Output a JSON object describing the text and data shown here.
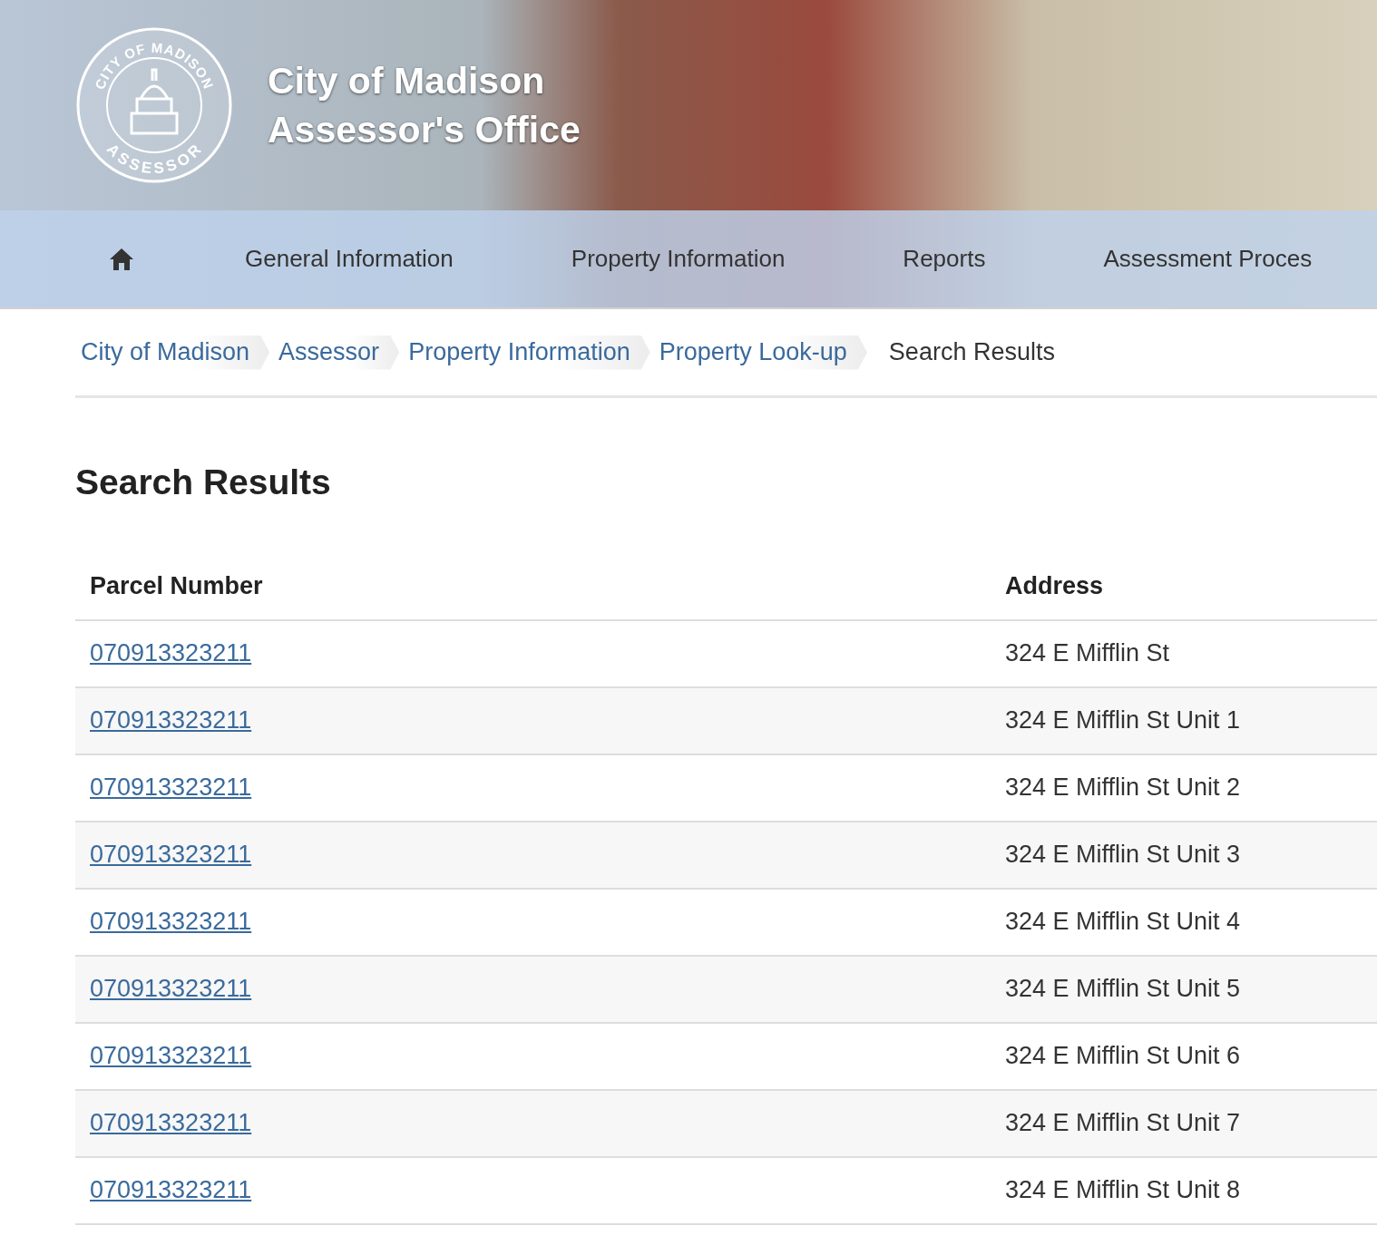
{
  "header": {
    "seal_top": "CITY OF MADISON",
    "seal_bottom": "ASSESSOR",
    "title_line_1": "City of Madison",
    "title_line_2": "Assessor's Office"
  },
  "nav": {
    "items": [
      {
        "kind": "home"
      },
      {
        "kind": "text",
        "label": "General Information"
      },
      {
        "kind": "text",
        "label": "Property Information"
      },
      {
        "kind": "text",
        "label": "Reports"
      },
      {
        "kind": "text",
        "label": "Assessment Proces"
      }
    ]
  },
  "breadcrumb": [
    {
      "label": "City of Madison",
      "current": false
    },
    {
      "label": "Assessor",
      "current": false
    },
    {
      "label": "Property Information",
      "current": false
    },
    {
      "label": "Property Look-up",
      "current": false
    },
    {
      "label": "Search Results",
      "current": true
    }
  ],
  "heading": "Search Results",
  "table": {
    "columns": [
      "Parcel Number",
      "Address"
    ],
    "rows": [
      {
        "parcel": "070913323211",
        "address": "324 E Mifflin St"
      },
      {
        "parcel": "070913323211",
        "address": "324 E Mifflin St Unit 1"
      },
      {
        "parcel": "070913323211",
        "address": "324 E Mifflin St Unit 2"
      },
      {
        "parcel": "070913323211",
        "address": "324 E Mifflin St Unit 3"
      },
      {
        "parcel": "070913323211",
        "address": "324 E Mifflin St Unit 4"
      },
      {
        "parcel": "070913323211",
        "address": "324 E Mifflin St Unit 5"
      },
      {
        "parcel": "070913323211",
        "address": "324 E Mifflin St Unit 6"
      },
      {
        "parcel": "070913323211",
        "address": "324 E Mifflin St Unit 7"
      },
      {
        "parcel": "070913323211",
        "address": "324 E Mifflin St Unit 8"
      }
    ]
  }
}
